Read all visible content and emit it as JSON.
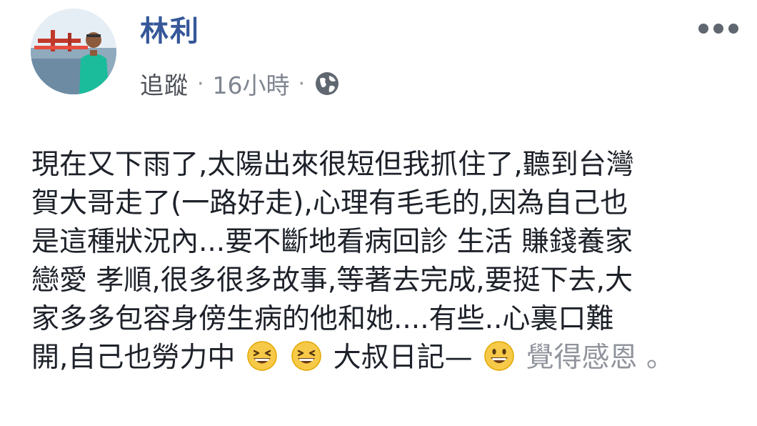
{
  "author": {
    "name": "林利"
  },
  "meta": {
    "follow_label": "追蹤",
    "separator": "·",
    "time": "16小時",
    "audience_icon": "globe-icon"
  },
  "menu_icon": "more-horizontal-icon",
  "post": {
    "lines": [
      "現在又下雨了,太陽出來很短但我抓住了,聽到台灣",
      "賀大哥走了(一路好走),心理有毛毛的,因為自己也",
      "是這種狀況內...要不斷地看病回診 生活 賺錢養家",
      "戀愛 孝順,很多很多故事,等著去完成,要挺下去,大",
      "家多多包容身傍生病的他和她....有些..心裏口難"
    ],
    "last_line": {
      "part1": "開,自己也勞力中",
      "emoji1": "grinning-squinting-face-emoji",
      "emoji2": "grinning-squinting-face-emoji",
      "part2": "大叔日記—",
      "emoji3": "grinning-face-emoji",
      "feeling": "覺得感恩",
      "end": "。"
    }
  },
  "colors": {
    "name_link": "#365899",
    "meta_text": "#606770",
    "body_text": "#1d2129",
    "feeling_text": "#90949c"
  }
}
